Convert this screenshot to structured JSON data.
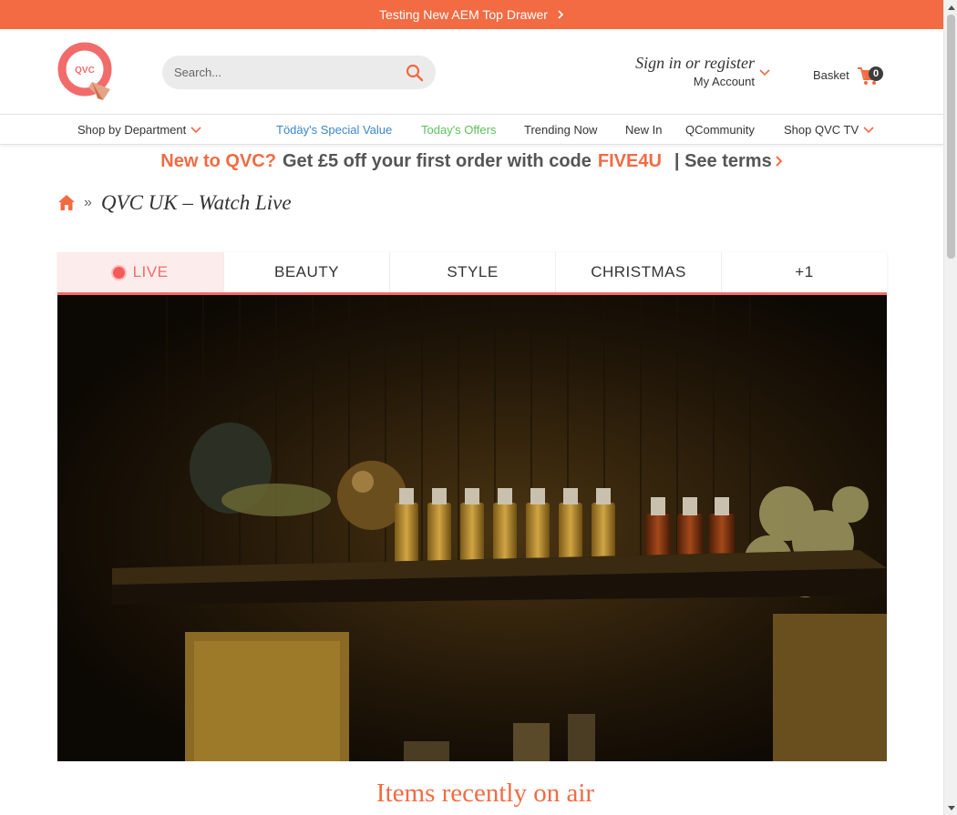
{
  "top_banner": {
    "text": "Testing New AEM Top Drawer",
    "icon": "chevron-right-icon"
  },
  "header": {
    "logo_text": "QVC",
    "search": {
      "placeholder": "Search...",
      "icon": "search-icon"
    },
    "account": {
      "signin_label": "Sign in or register",
      "my_account_label": "My Account",
      "icon": "chevron-down-icon"
    },
    "basket": {
      "label": "Basket",
      "count": "0",
      "icon": "cart-icon"
    }
  },
  "nav": {
    "shop_by_department": "Shop by Department",
    "todays_special_value": "Tödäy's Special Value",
    "todays_offers": "Today's Offers",
    "trending_now": "Trending Now",
    "new_in": "New In",
    "qcommunity": "QCommunity",
    "shop_qvc_tv": "Shop QVC TV"
  },
  "promo": {
    "lead": "New to QVC?",
    "middle": "Get £5 off your first order with code",
    "code": "FIVE4U",
    "terms": "| See terms"
  },
  "breadcrumb": {
    "separator": "»",
    "current": "QVC UK – Watch Live",
    "icon": "home-icon"
  },
  "tabs": [
    {
      "label": "LIVE",
      "active": true
    },
    {
      "label": "BEAUTY",
      "active": false
    },
    {
      "label": "STYLE",
      "active": false
    },
    {
      "label": "CHRISTMAS",
      "active": false
    },
    {
      "label": "+1",
      "active": false
    }
  ],
  "recent": {
    "heading": "Items recently on air"
  },
  "colors": {
    "brand_orange": "#f26b43",
    "live_red": "#f26b6b",
    "tsv_blue": "#3b86c8",
    "offers_green": "#5cbf5c"
  }
}
